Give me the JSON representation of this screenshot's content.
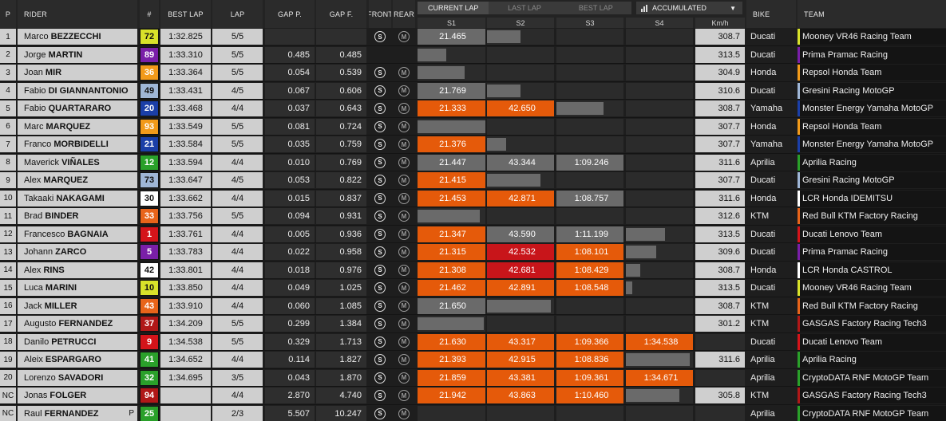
{
  "header": {
    "pos": "P",
    "rider": "RIDER",
    "num": "#",
    "best_lap": "BEST LAP",
    "lap": "LAP",
    "gap_p": "GAP P.",
    "gap_f": "GAP F.",
    "front": "FRONT",
    "rear": "REAR",
    "tabs": [
      "CURRENT LAP",
      "LAST LAP",
      "BEST LAP"
    ],
    "active_tab": 0,
    "accumulated": "ACCUMULATED",
    "sectors": [
      "S1",
      "S2",
      "S3",
      "S4"
    ],
    "speed": "Km/h",
    "bike": "BIKE",
    "team": "TEAM"
  },
  "colors": {
    "orange_sector": "#e55a0a",
    "red_sector": "#c8151a",
    "grey_sector": "#6a6a6a"
  },
  "tyre_icons": {
    "front": "soft-tyre-icon",
    "rear": "medium-tyre-icon",
    "front_letter": "S",
    "rear_letter": "M"
  },
  "riders": [
    {
      "pos": "1",
      "first": "Marco",
      "last": "BEZZECCHI",
      "num": "72",
      "num_bg": "#d8e22a",
      "num_fg": "#111",
      "best": "1:32.825",
      "lap": "5/5",
      "gap_p": "",
      "gap_f": "",
      "s1": "21.465",
      "s1c": "grey",
      "s2": "",
      "s2c": "",
      "s2bar": 0.5,
      "s3": "",
      "s3c": "",
      "s3bar": 0,
      "s4": "",
      "s4c": "",
      "s4bar": 0,
      "speed": "308.7",
      "bike": "Ducati",
      "team": "Mooney VR46 Racing Team",
      "team_color": "#d8e22a"
    },
    {
      "pos": "2",
      "first": "Jorge",
      "last": "MARTIN",
      "num": "89",
      "num_bg": "#7a1fa8",
      "num_fg": "#fff",
      "best": "1:33.310",
      "lap": "5/5",
      "gap_p": "0.485",
      "gap_f": "0.485",
      "s1": "",
      "s1c": "",
      "s1bar": 0.42,
      "s2": "",
      "s2c": "",
      "s2bar": 0,
      "s3": "",
      "s3c": "",
      "s3bar": 0,
      "s4": "",
      "s4c": "",
      "s4bar": 0,
      "speed": "313.5",
      "bike": "Ducati",
      "team": "Prima Pramac Racing",
      "team_color": "#7a1fa8"
    },
    {
      "pos": "3",
      "first": "Joan",
      "last": "MIR",
      "num": "36",
      "num_bg": "#f29a1a",
      "num_fg": "#fff",
      "best": "1:33.364",
      "lap": "5/5",
      "gap_p": "0.054",
      "gap_f": "0.539",
      "s1": "",
      "s1c": "",
      "s1bar": 0.7,
      "s2": "",
      "s2c": "",
      "s2bar": 0,
      "s3": "",
      "s3c": "",
      "s3bar": 0,
      "s4": "",
      "s4c": "",
      "s4bar": 0,
      "speed": "304.9",
      "bike": "Honda",
      "team": "Repsol Honda Team",
      "team_color": "#f29a1a"
    },
    {
      "pos": "4",
      "first": "Fabio",
      "last": "DI GIANNANTONIO",
      "num": "49",
      "num_bg": "#9fb6d6",
      "num_fg": "#111",
      "best": "1:33.431",
      "lap": "4/5",
      "gap_p": "0.067",
      "gap_f": "0.606",
      "s1": "21.769",
      "s1c": "grey",
      "s2": "",
      "s2c": "",
      "s2bar": 0.5,
      "s3": "",
      "s3c": "",
      "s3bar": 0,
      "s4": "",
      "s4c": "",
      "s4bar": 0,
      "speed": "310.6",
      "bike": "Ducati",
      "team": "Gresini Racing MotoGP",
      "team_color": "#9fb6d6"
    },
    {
      "pos": "5",
      "first": "Fabio",
      "last": "QUARTARARO",
      "num": "20",
      "num_bg": "#1b3fa8",
      "num_fg": "#fff",
      "best": "1:33.468",
      "lap": "4/4",
      "gap_p": "0.037",
      "gap_f": "0.643",
      "s1": "21.333",
      "s1c": "orange",
      "s2": "42.650",
      "s2c": "orange",
      "s3": "",
      "s3c": "",
      "s3bar": 0.7,
      "s4": "",
      "s4c": "",
      "s4bar": 0,
      "speed": "308.7",
      "bike": "Yamaha",
      "team": "Monster Energy Yamaha MotoGP",
      "team_color": "#1b3fa8"
    },
    {
      "pos": "6",
      "first": "Marc",
      "last": "MARQUEZ",
      "num": "93",
      "num_bg": "#f29a1a",
      "num_fg": "#fff",
      "best": "1:33.549",
      "lap": "5/5",
      "gap_p": "0.081",
      "gap_f": "0.724",
      "s1": "",
      "s1c": "",
      "s1bar": 1.0,
      "s2": "",
      "s2c": "",
      "s2bar": 0,
      "s3": "",
      "s3c": "",
      "s3bar": 0,
      "s4": "",
      "s4c": "",
      "s4bar": 0,
      "speed": "307.7",
      "bike": "Honda",
      "team": "Repsol Honda Team",
      "team_color": "#f29a1a"
    },
    {
      "pos": "7",
      "first": "Franco",
      "last": "MORBIDELLI",
      "num": "21",
      "num_bg": "#1b3fa8",
      "num_fg": "#fff",
      "best": "1:33.584",
      "lap": "5/5",
      "gap_p": "0.035",
      "gap_f": "0.759",
      "s1": "21.376",
      "s1c": "orange",
      "s2": "",
      "s2c": "",
      "s2bar": 0.28,
      "s3": "",
      "s3c": "",
      "s3bar": 0,
      "s4": "",
      "s4c": "",
      "s4bar": 0,
      "speed": "307.7",
      "bike": "Yamaha",
      "team": "Monster Energy Yamaha MotoGP",
      "team_color": "#1b3fa8"
    },
    {
      "pos": "8",
      "first": "Maverick",
      "last": "VIÑALES",
      "num": "12",
      "num_bg": "#2aa02a",
      "num_fg": "#fff",
      "best": "1:33.594",
      "lap": "4/4",
      "gap_p": "0.010",
      "gap_f": "0.769",
      "s1": "21.447",
      "s1c": "grey",
      "s2": "43.344",
      "s2c": "grey",
      "s3": "1:09.246",
      "s3c": "grey",
      "s4": "",
      "s4c": "",
      "s4bar": 0,
      "speed": "311.6",
      "bike": "Aprilia",
      "team": "Aprilia Racing",
      "team_color": "#2aa02a"
    },
    {
      "pos": "9",
      "first": "Alex",
      "last": "MARQUEZ",
      "num": "73",
      "num_bg": "#9fb6d6",
      "num_fg": "#111",
      "best": "1:33.647",
      "lap": "4/5",
      "gap_p": "0.053",
      "gap_f": "0.822",
      "s1": "21.415",
      "s1c": "orange",
      "s2": "",
      "s2c": "",
      "s2bar": 0.8,
      "s3": "",
      "s3c": "",
      "s3bar": 0,
      "s4": "",
      "s4c": "",
      "s4bar": 0,
      "speed": "307.7",
      "bike": "Ducati",
      "team": "Gresini Racing MotoGP",
      "team_color": "#9fb6d6"
    },
    {
      "pos": "10",
      "first": "Takaaki",
      "last": "NAKAGAMI",
      "num": "30",
      "num_bg": "#ffffff",
      "num_fg": "#111",
      "best": "1:33.662",
      "lap": "4/4",
      "gap_p": "0.015",
      "gap_f": "0.837",
      "s1": "21.453",
      "s1c": "orange",
      "s2": "42.871",
      "s2c": "orange",
      "s3": "1:08.757",
      "s3c": "grey",
      "s4": "",
      "s4c": "",
      "s4bar": 0,
      "speed": "311.6",
      "bike": "Honda",
      "team": "LCR Honda IDEMITSU",
      "team_color": "#ffffff"
    },
    {
      "pos": "11",
      "first": "Brad",
      "last": "BINDER",
      "num": "33",
      "num_bg": "#e8641a",
      "num_fg": "#fff",
      "best": "1:33.756",
      "lap": "5/5",
      "gap_p": "0.094",
      "gap_f": "0.931",
      "s1": "",
      "s1c": "",
      "s1bar": 0.92,
      "s2": "",
      "s2c": "",
      "s2bar": 0,
      "s3": "",
      "s3c": "",
      "s3bar": 0,
      "s4": "",
      "s4c": "",
      "s4bar": 0,
      "speed": "312.6",
      "bike": "KTM",
      "team": "Red Bull KTM Factory Racing",
      "team_color": "#e8641a"
    },
    {
      "pos": "12",
      "first": "Francesco",
      "last": "BAGNAIA",
      "num": "1",
      "num_bg": "#d4141a",
      "num_fg": "#fff",
      "best": "1:33.761",
      "lap": "4/4",
      "gap_p": "0.005",
      "gap_f": "0.936",
      "s1": "21.347",
      "s1c": "orange",
      "s2": "43.590",
      "s2c": "grey",
      "s3": "1:11.199",
      "s3c": "grey",
      "s4": "",
      "s4c": "",
      "s4bar": 0.58,
      "speed": "313.5",
      "bike": "Ducati",
      "team": "Ducati Lenovo Team",
      "team_color": "#d4141a"
    },
    {
      "pos": "13",
      "first": "Johann",
      "last": "ZARCO",
      "num": "5",
      "num_bg": "#7a1fa8",
      "num_fg": "#fff",
      "best": "1:33.783",
      "lap": "4/4",
      "gap_p": "0.022",
      "gap_f": "0.958",
      "s1": "21.315",
      "s1c": "orange",
      "s2": "42.532",
      "s2c": "red",
      "s3": "1:08.101",
      "s3c": "orange",
      "s4": "",
      "s4c": "",
      "s4bar": 0.45,
      "speed": "309.6",
      "bike": "Ducati",
      "team": "Prima Pramac Racing",
      "team_color": "#7a1fa8"
    },
    {
      "pos": "14",
      "first": "Alex",
      "last": "RINS",
      "num": "42",
      "num_bg": "#ffffff",
      "num_fg": "#111",
      "best": "1:33.801",
      "lap": "4/4",
      "gap_p": "0.018",
      "gap_f": "0.976",
      "s1": "21.308",
      "s1c": "orange",
      "s2": "42.681",
      "s2c": "red",
      "s3": "1:08.429",
      "s3c": "orange",
      "s4": "",
      "s4c": "",
      "s4bar": 0.22,
      "speed": "308.7",
      "bike": "Honda",
      "team": "LCR Honda CASTROL",
      "team_color": "#ffffff"
    },
    {
      "pos": "15",
      "first": "Luca",
      "last": "MARINI",
      "num": "10",
      "num_bg": "#d8e22a",
      "num_fg": "#111",
      "best": "1:33.850",
      "lap": "4/4",
      "gap_p": "0.049",
      "gap_f": "1.025",
      "s1": "21.462",
      "s1c": "orange",
      "s2": "42.891",
      "s2c": "orange",
      "s3": "1:08.548",
      "s3c": "orange",
      "s4": "",
      "s4c": "",
      "s4bar": 0.1,
      "speed": "313.5",
      "bike": "Ducati",
      "team": "Mooney VR46 Racing Team",
      "team_color": "#d8e22a"
    },
    {
      "pos": "16",
      "first": "Jack",
      "last": "MILLER",
      "num": "43",
      "num_bg": "#e8641a",
      "num_fg": "#fff",
      "best": "1:33.910",
      "lap": "4/4",
      "gap_p": "0.060",
      "gap_f": "1.085",
      "s1": "21.650",
      "s1c": "grey",
      "s2": "",
      "s2c": "",
      "s2bar": 0.95,
      "s3": "",
      "s3c": "",
      "s3bar": 0,
      "s4": "",
      "s4c": "",
      "s4bar": 0,
      "speed": "308.7",
      "bike": "KTM",
      "team": "Red Bull KTM Factory Racing",
      "team_color": "#e8641a"
    },
    {
      "pos": "17",
      "first": "Augusto",
      "last": "FERNANDEZ",
      "num": "37",
      "num_bg": "#b01818",
      "num_fg": "#fff",
      "best": "1:34.209",
      "lap": "5/5",
      "gap_p": "0.299",
      "gap_f": "1.384",
      "s1": "",
      "s1c": "",
      "s1bar": 0.98,
      "s2": "",
      "s2c": "",
      "s2bar": 0,
      "s3": "",
      "s3c": "",
      "s3bar": 0,
      "s4": "",
      "s4c": "",
      "s4bar": 0,
      "speed": "301.2",
      "bike": "KTM",
      "team": "GASGAS Factory Racing Tech3",
      "team_color": "#b01818"
    },
    {
      "pos": "18",
      "first": "Danilo",
      "last": "PETRUCCI",
      "num": "9",
      "num_bg": "#d4141a",
      "num_fg": "#fff",
      "best": "1:34.538",
      "lap": "5/5",
      "gap_p": "0.329",
      "gap_f": "1.713",
      "s1": "21.630",
      "s1c": "orange",
      "s2": "43.317",
      "s2c": "orange",
      "s3": "1:09.366",
      "s3c": "orange",
      "s4": "1:34.538",
      "s4c": "orange",
      "speed": "",
      "bike": "Ducati",
      "team": "Ducati Lenovo Team",
      "team_color": "#d4141a"
    },
    {
      "pos": "19",
      "first": "Aleix",
      "last": "ESPARGARO",
      "num": "41",
      "num_bg": "#2aa02a",
      "num_fg": "#fff",
      "best": "1:34.652",
      "lap": "4/4",
      "gap_p": "0.114",
      "gap_f": "1.827",
      "s1": "21.393",
      "s1c": "orange",
      "s2": "42.915",
      "s2c": "orange",
      "s3": "1:08.836",
      "s3c": "orange",
      "s4": "",
      "s4c": "",
      "s4bar": 0.95,
      "speed": "311.6",
      "bike": "Aprilia",
      "team": "Aprilia Racing",
      "team_color": "#2aa02a"
    },
    {
      "pos": "20",
      "first": "Lorenzo",
      "last": "SAVADORI",
      "num": "32",
      "num_bg": "#2aa02a",
      "num_fg": "#fff",
      "best": "1:34.695",
      "lap": "3/5",
      "gap_p": "0.043",
      "gap_f": "1.870",
      "s1": "21.859",
      "s1c": "orange",
      "s2": "43.381",
      "s2c": "orange",
      "s3": "1:09.361",
      "s3c": "orange",
      "s4": "1:34.671",
      "s4c": "orange",
      "speed": "",
      "bike": "Aprilia",
      "team": "CryptoDATA RNF MotoGP Team",
      "team_color": "#2aa02a"
    },
    {
      "pos": "NC",
      "first": "Jonas",
      "last": "FOLGER",
      "num": "94",
      "num_bg": "#b01818",
      "num_fg": "#fff",
      "best": "",
      "lap": "4/4",
      "gap_p": "2.870",
      "gap_f": "4.740",
      "s1": "21.942",
      "s1c": "orange",
      "s2": "43.863",
      "s2c": "orange",
      "s3": "1:10.460",
      "s3c": "orange",
      "s4": "",
      "s4c": "",
      "s4bar": 0.8,
      "speed": "305.8",
      "bike": "KTM",
      "team": "GASGAS Factory Racing Tech3",
      "team_color": "#b01818"
    },
    {
      "pos": "NC",
      "first": "Raul",
      "last": "FERNANDEZ",
      "pit": "P",
      "num": "25",
      "num_bg": "#2aa02a",
      "num_fg": "#fff",
      "best": "",
      "lap": "2/3",
      "gap_p": "5.507",
      "gap_f": "10.247",
      "s1": "",
      "s1c": "",
      "s1bar": 0,
      "s2": "",
      "s2c": "",
      "s2bar": 0,
      "s3": "",
      "s3c": "",
      "s3bar": 0,
      "s4": "",
      "s4c": "",
      "s4bar": 0,
      "speed": "",
      "bike": "Aprilia",
      "team": "CryptoDATA RNF MotoGP Team",
      "team_color": "#2aa02a"
    }
  ]
}
